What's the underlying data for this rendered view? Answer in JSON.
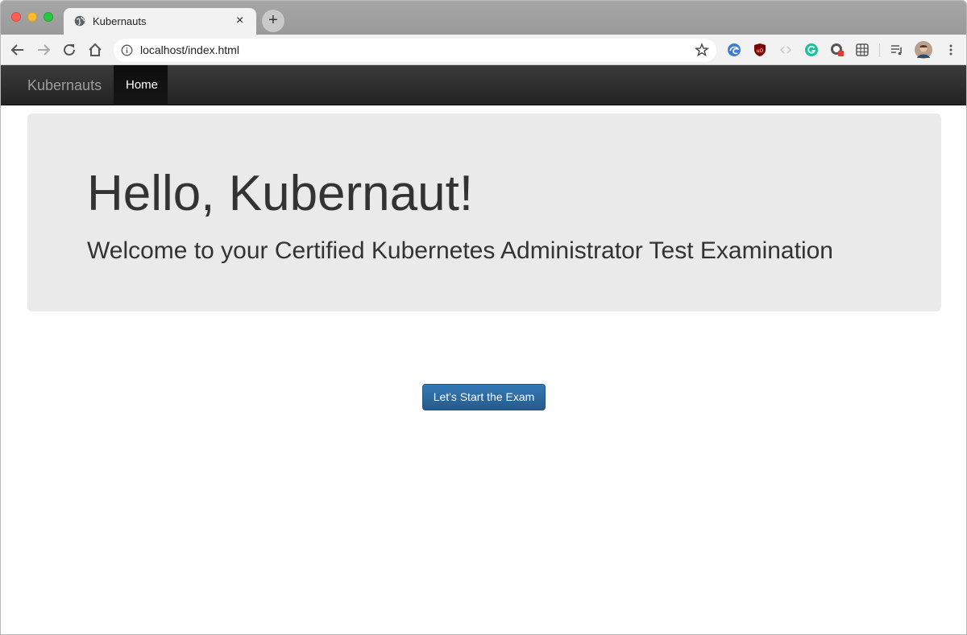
{
  "browser": {
    "tab": {
      "title": "Kubernauts",
      "close_glyph": "×",
      "favicon": "globe-icon"
    },
    "new_tab_glyph": "+",
    "address_bar": {
      "url": "localhost/index.html"
    }
  },
  "navbar": {
    "brand": "Kubernauts",
    "items": [
      {
        "label": "Home",
        "active": true
      }
    ]
  },
  "jumbotron": {
    "title": "Hello, Kubernaut!",
    "subtitle": "Welcome to your Certified Kubernetes Administrator Test Examination"
  },
  "main": {
    "start_button_label": "Let's Start the Exam"
  },
  "colors": {
    "navbar_bg": "#222222",
    "jumbotron_bg": "#eaeaea",
    "primary_button": "#337ab7"
  }
}
